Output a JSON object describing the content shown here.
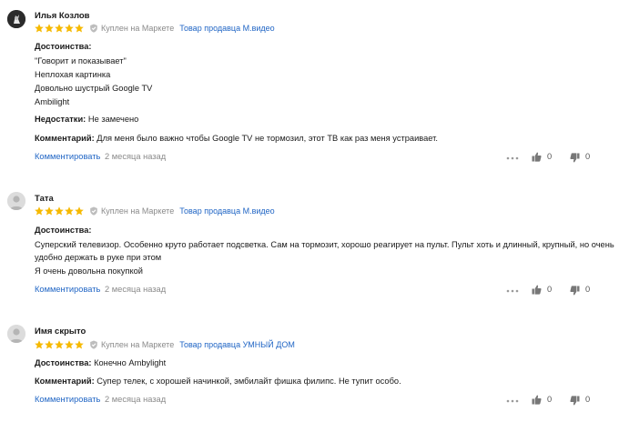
{
  "reviews": [
    {
      "author": "Илья Козлов",
      "rating": 5,
      "bought": "Куплен на Маркете",
      "seller": "Товар продавца М.видео",
      "pros_label": "Достоинства:",
      "pros_lines": [
        "\"Говорит и показывает\"",
        "Неплохая картинка",
        "Довольно шустрый Google TV",
        "Ambilight"
      ],
      "cons_label": "Недостатки:",
      "cons": "Не замечено",
      "comment_label": "Комментарий:",
      "comment": "Для меня было важно чтобы Google TV не тормозил, этот ТВ как раз меня устраивает.",
      "comment_link": "Комментировать",
      "ago": "2 месяца назад",
      "likes": "0",
      "dislikes": "0"
    },
    {
      "author": "Тата",
      "rating": 5,
      "bought": "Куплен на Маркете",
      "seller": "Товар продавца М.видео",
      "pros_label": "Достоинства:",
      "pros_lines": [
        "Суперский телевизор. Особенно круто работает подсветка. Сам на тормозит, хорошо реагирует на пульт. Пульт хоть и длинный, крупный, но очень",
        "удобно держать в руке при этом",
        "Я очень довольна покупкой"
      ],
      "comment_link": "Комментировать",
      "ago": "2 месяца назад",
      "likes": "0",
      "dislikes": "0"
    },
    {
      "author": "Имя скрыто",
      "rating": 5,
      "bought": "Куплен на Маркете",
      "seller": "Товар продавца УМНЫЙ ДОМ",
      "pros_label": "Достоинства:",
      "pros_inline": "Конечно Ambylight",
      "comment_label": "Комментарий:",
      "comment": "Супер телек, с хорошей начинкой, эмбилайт фишка филипс. Не тупит особо.",
      "comment_link": "Комментировать",
      "ago": "2 месяца назад",
      "likes": "0",
      "dislikes": "0"
    }
  ],
  "colors": {
    "star": "#f6b900",
    "link": "#2166c5",
    "muted": "#8a8a8a"
  },
  "icons": [
    "star-icon",
    "check-icon",
    "more-dots-icon",
    "thumb-up-icon",
    "thumb-down-icon",
    "avatar-placeholder-icon"
  ]
}
